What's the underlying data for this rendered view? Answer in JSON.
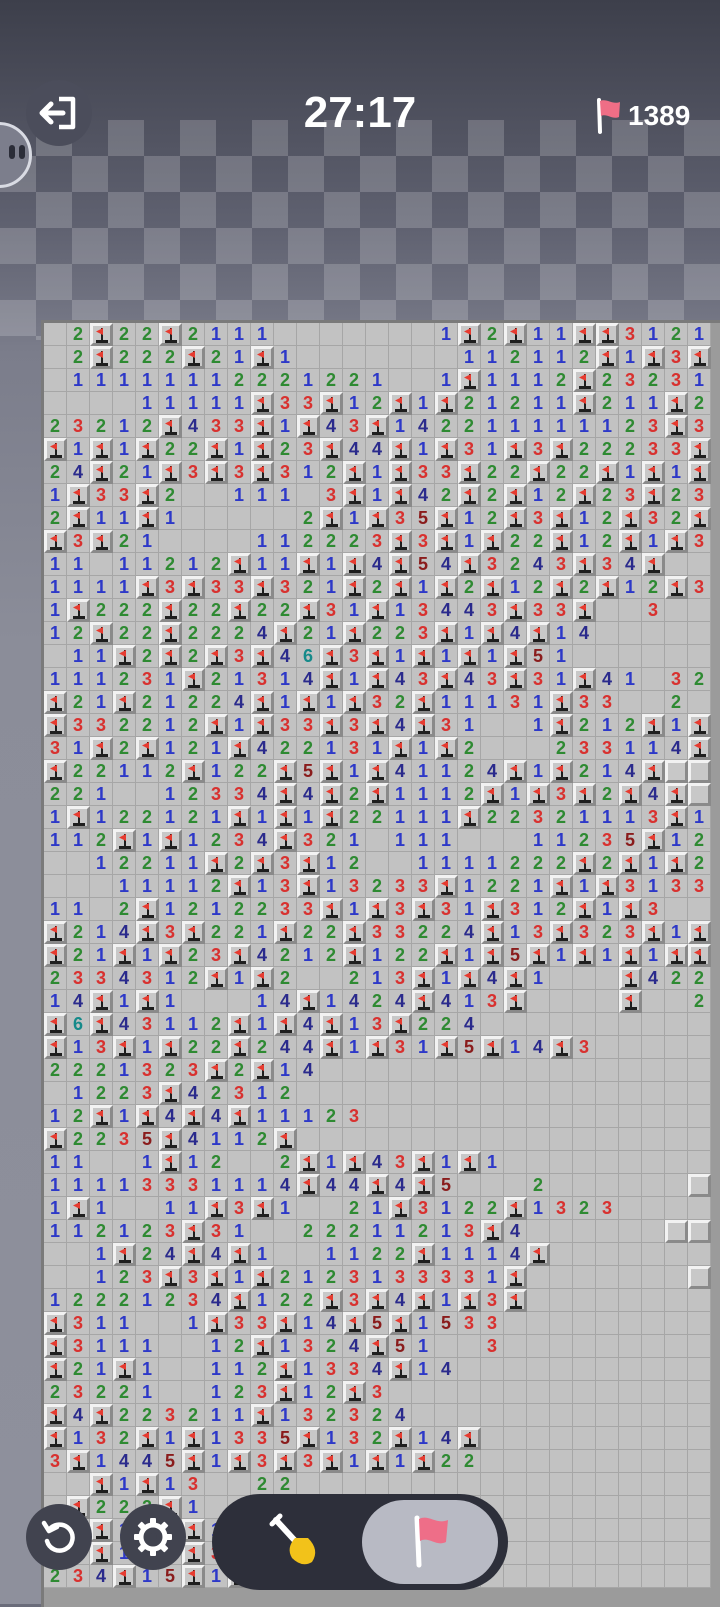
{
  "header": {
    "timer": "27:17",
    "flags_remaining": "1389"
  },
  "icons": {
    "exit": "exit-icon",
    "flag_counter": "flag-icon",
    "undo": "undo-icon",
    "settings": "gear-icon",
    "dig": "shovel-icon",
    "flag_mode": "flag-icon"
  },
  "colors": {
    "one": "#2d38c8",
    "two": "#2e8a32",
    "three": "#d8312f",
    "four": "#2a2a8c",
    "five": "#8a1c1c",
    "six": "#158a8a",
    "flag": "#e8405a"
  },
  "board": {
    "legend": "digits = revealed numbers, F = flag, . = revealed empty, # = unrevealed",
    "rows": [
      ".2F22F211 1 .......1F2F11FF3121F1",
      ".2F222F21F1 .......112112F1F3F2F222",
      ".1111111222122 1 ..1F1112F232311 1F",
      "....11111F33F12F1F2 1211F211F21.23",
      "23212F4 33F1F43F1 42211111123F3F22F",
      "F1F1F22F1F23F44F1F31F3F22233F3F4F1F2",
      "24F21F3F3F312F1F33F22F2 2F1F1F31F4F1F53",
      "1F33F2 ..111.3F1F42F2F12F23F23F223F1F5F1F1",
      "2F11F1 .....2F1F35F12F3F12F32F2F21F.....42",
      "F3F21 ....112223F3F1F22F12F1F3F22 ....F1",
      "11 .1121 2F11F1F4F54F3243F34F ...1 ...33",
      "1111F3F33F3 21F2F1F2F12F2F12F31F ....5F3",
      "1F222F22F22F31F13443F33F ..3 ....F23",
      "12F22F2224F21F223F1F4F14 ........321",
      ".11F2F2F3F46F3F1F1F1F51 ........1F1",
      "111231F21314F1F43F43F31F41 .321 ..31",
      "F21F21224F1F1F32F11131F33 ..2 ...31",
      "F33221 2F1F33F3F4F31 ..1F21 2F1F ..F21",
      "31F2F1 21F4 22131F1F2 ...233114F .....",
      "F22112F12 2F5F1F41 1 24F1F214F",
      "221 ..12 33 4F4F2F111 2F1F3F2F4F",
      "1F122121F1F1F22111F2232111 3F1F32",
      "112F1F1234F321 .111 ...11235F121",
      "..1221 1F2F3F12 ..1111222F2F1F222",
      "...11112F13F13233F1221F1F313332F2F1",
      "11 .2F1212233F1F3F31F312F1F3 ..2 F21F1F4",
      "F21 4F3F221F22F33224F13F3 23F1F2 23",
      "F21F1F23F4212F122F1F5F1 F1F1F F1F3 1 1 1F",
      "2 33 4 3 12F1F2 ..2 1 3F1F4F1 ...F4 2 2 2 2",
      "1 4F1F1 ...14F14 2 4F4 13F ....F ..2",
      "F 6F4 3 1 1 2F1F4F1 3F2 2 4 ..........",
      "F1 3F1F2 2F2 4 4F1F3 1F5F1 4F3 .........",
      "2 2 2 1 3 2 3F2F1 4 .................",
      ".1 2 2 3F4 2 3 1 2 ..................",
      "1 2F1F4F4F1 1 1 2 3 .................",
      "F2 2 3 5F4 1 1 2F ..................",
      "1 1 ..1F1 2 ..2F1F4 3F1F1 ..........",
      "1 1 1 1 3 3 3 1 1 1 4F4 4F4F5 ...2 ......",
      "1F1 ..1 1F3F1 ..2 1F3 1 2 2F1 3 2 3 ......",
      "1 1 2 1 2 3F3 1 ..2 2 2 1 1 2 1 3F4 ......",
      "..1F2 4F4F1 ..1 1 2 2F1 1 1 4F .......",
      "..1 2 3 F3F1F2 1 2 3 1 3 3 3 3 1F .......",
      "1 2 2 2 1 2 3 4F1 2 2F3F4F1F3F .........",
      "F3 1 1 ..1 F3 3F1 4F5F1 5 3 3 .........",
      "F3 1 1 1 ..1 2F1 3 2 4F5 1 ..3 .........",
      "F2 1F1 ..1 1 2F1 3 3 4F1 4 .............",
      "2 3 2 2 1 ..1 2 3F1 2 F3 ..............",
      "F4 F2 2 3 2 1 1F1 3 2 3 2 4 .............",
      "F1 3 2F1F1 3 3 5F1 3 2F1 4F .............",
      "3F1 4 4 5F1F3F3F1F1F2 2 ...............",
      "..F1F1 3 ..2 2 ......................",
      ".F2 2 2F1 ...2 .......................",
      ".2F1F1F1F1F1 2 F1 .....................",
      "F2F1F1F3 2 2 F1 .......................",
      "2 3 4F1 5F1F4 5 F1F1 ..................."
    ]
  }
}
